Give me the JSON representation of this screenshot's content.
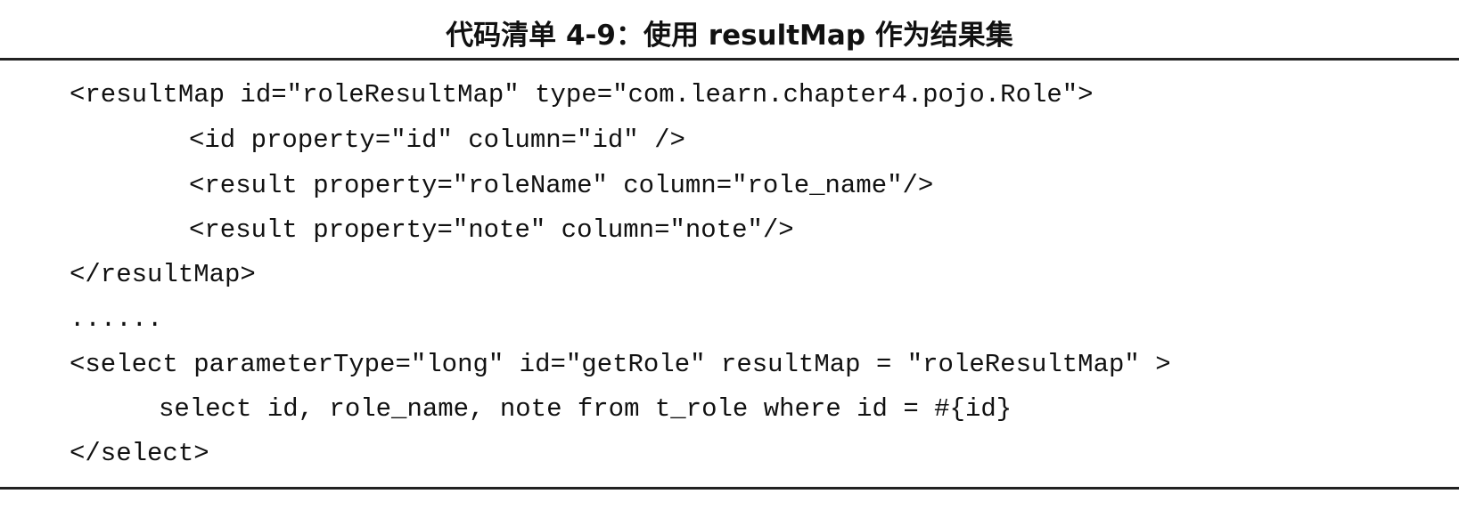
{
  "listing": {
    "title": "代码清单 4-9：使用 resultMap 作为结果集",
    "code_lines": [
      "<resultMap id=\"roleResultMap\" type=\"com.learn.chapter4.pojo.Role\">",
      "<id property=\"id\" column=\"id\" />",
      "<result property=\"roleName\" column=\"role_name\"/>",
      "<result property=\"note\" column=\"note\"/>",
      "</resultMap>",
      "......",
      "<select parameterType=\"long\" id=\"getRole\" resultMap = \"roleResultMap\" >",
      "select id, role_name, note from t_role where id = #{id}",
      "</select>"
    ]
  }
}
